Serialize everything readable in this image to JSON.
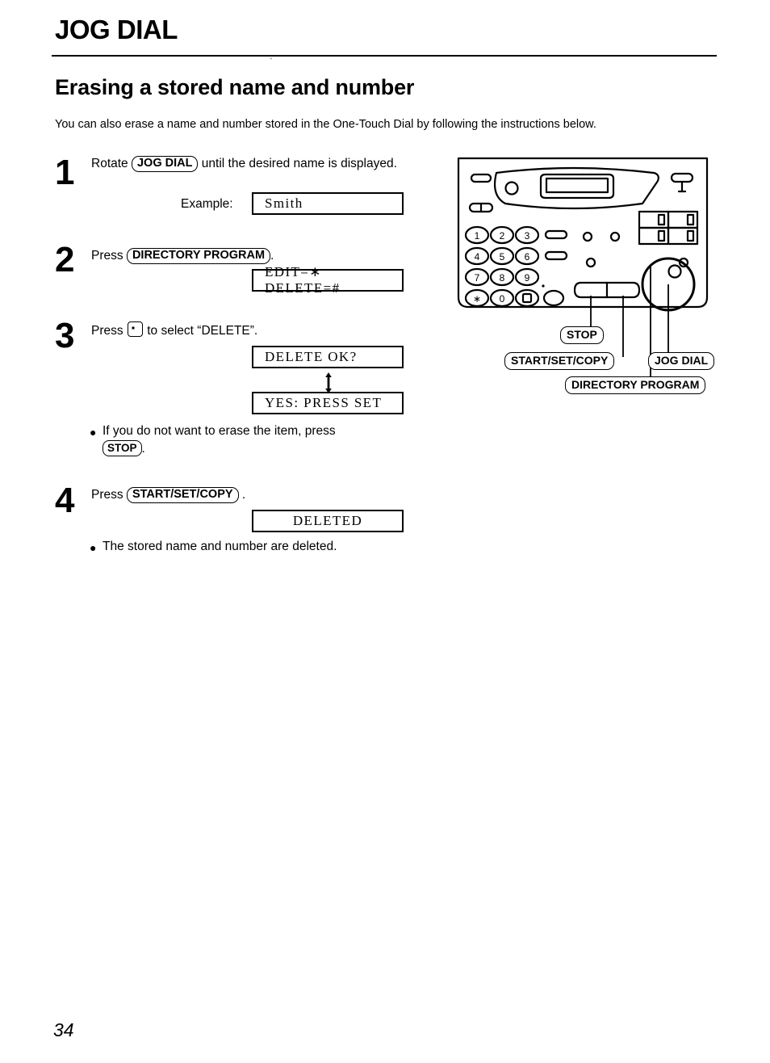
{
  "header": {
    "running_head": "JOG DIAL",
    "section_title": "Erasing a stored name and number",
    "intro": "You can also erase a name and number stored in the One-Touch Dial by following the instructions below."
  },
  "steps": [
    {
      "number": "1",
      "text_before": "Rotate",
      "key": "JOG DIAL",
      "text_after": "until the desired name is displayed.",
      "example_label": "Example:",
      "display": "Smith"
    },
    {
      "number": "2",
      "text_before": "Press",
      "key": "DIRECTORY PROGRAM",
      "text_after": ".",
      "display": "EDIT=∗ DELETE=#"
    },
    {
      "number": "3",
      "text_before": "Press",
      "key_icon": "hash-key-icon",
      "text_after": "to select “DELETE”.",
      "display_1": "DELETE OK?",
      "display_2": "YES: PRESS SET",
      "note": {
        "text_before": "If you do not want to erase the item, press",
        "key": "STOP",
        "text_after": "."
      }
    },
    {
      "number": "4",
      "text_before": "Press",
      "key": "START/SET/COPY",
      "text_after": ".",
      "display": "DELETED",
      "note": {
        "text": "The stored name and number are deleted."
      }
    }
  ],
  "device": {
    "keypad": [
      "1",
      "2",
      "3",
      "4",
      "5",
      "6",
      "7",
      "8",
      "9",
      "∗",
      "0",
      "#"
    ],
    "callouts": [
      {
        "label": "STOP"
      },
      {
        "label": "START/SET/COPY"
      },
      {
        "label": "JOG DIAL"
      },
      {
        "label": "DIRECTORY PROGRAM"
      }
    ]
  },
  "footer": {
    "page_number": "34"
  }
}
